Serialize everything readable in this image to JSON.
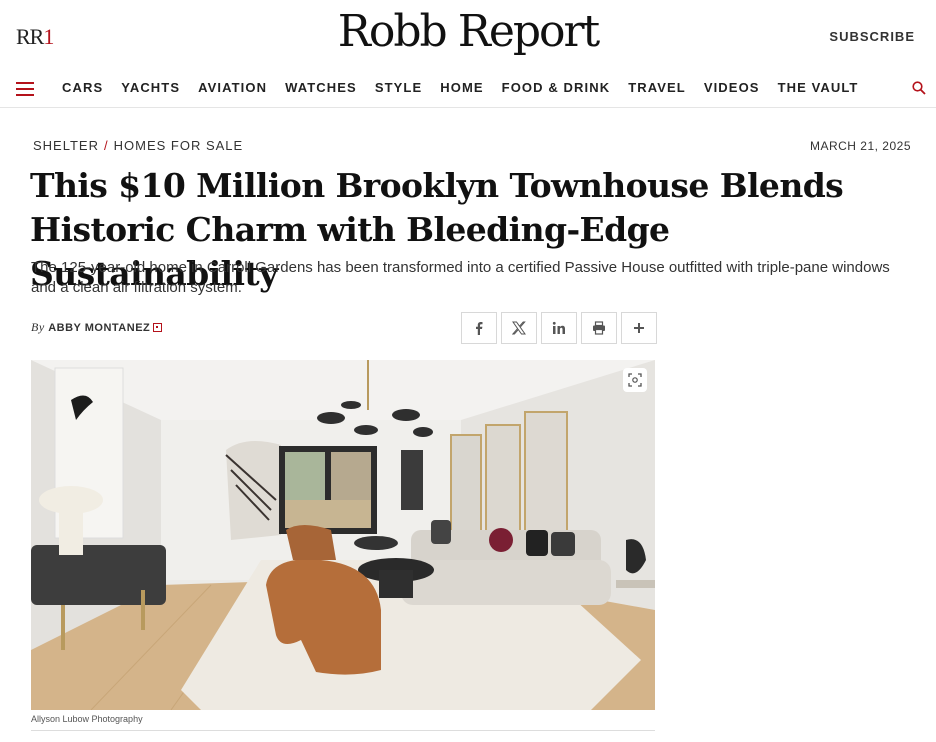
{
  "header": {
    "short_logo": "RR",
    "short_logo_accent": "1",
    "brand": "Robb Report",
    "subscribe_label": "SUBSCRIBE"
  },
  "nav": {
    "items": [
      "CARS",
      "YACHTS",
      "AVIATION",
      "WATCHES",
      "STYLE",
      "HOME",
      "FOOD & DRINK",
      "TRAVEL",
      "VIDEOS",
      "THE VAULT"
    ]
  },
  "article": {
    "breadcrumb": [
      "SHELTER",
      "HOMES FOR SALE"
    ],
    "breadcrumb_separator": "/",
    "date": "MARCH 21, 2025",
    "headline": "This $10 Million Brooklyn Townhouse Blends Historic Charm with Bleeding-Edge Sustainability",
    "dek": "The 125-year-old home in Carroll Gardens has been transformed into a certified Passive House outfitted with triple-pane windows and a clean air filtration system.",
    "byline_prefix": "By",
    "author": "ABBY MONTANEZ",
    "share_buttons": [
      "facebook-icon",
      "x-icon",
      "linkedin-icon",
      "print-icon",
      "plus-icon"
    ],
    "image_credit": "Allyson Lubow Photography"
  },
  "colors": {
    "accent": "#b4121b",
    "text": "#111111"
  }
}
